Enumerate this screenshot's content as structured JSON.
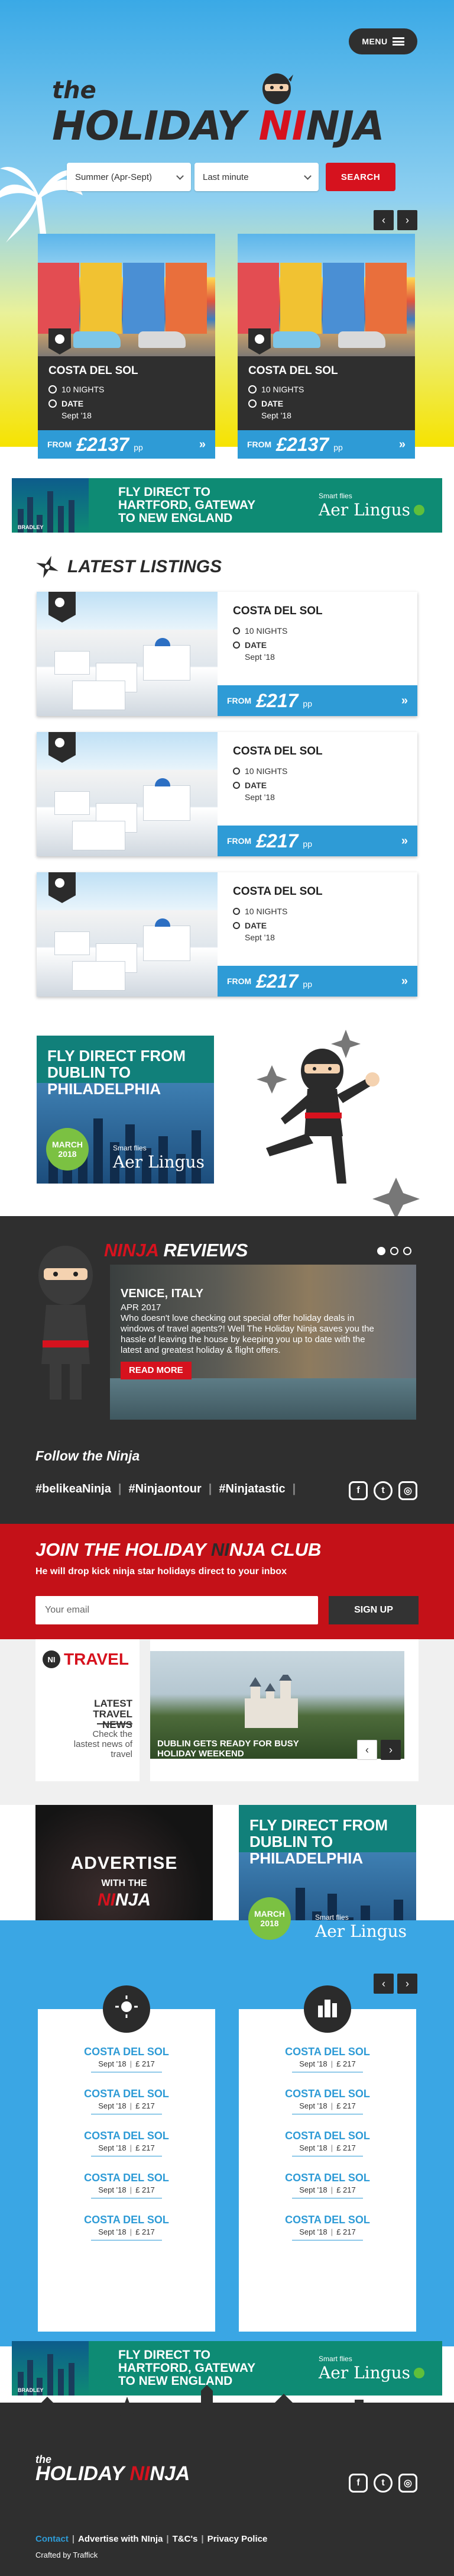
{
  "header": {
    "menu_label": "MENU",
    "logo_the": "the",
    "logo_holiday": "HOLIDAY",
    "logo_ni": "NI",
    "logo_nja": "NJA"
  },
  "search": {
    "when_value": "Summer (Apr-Sept)",
    "type_value": "Last minute",
    "button_label": "SEARCH"
  },
  "featured_deals": [
    {
      "title": "COSTA DEL SOL",
      "nights": "10 NIGHTS",
      "date_label": "DATE",
      "date": "Sept '18",
      "from": "FROM",
      "price": "£2137",
      "pp": "pp",
      "go": "»"
    },
    {
      "title": "COSTA DEL SOL",
      "nights": "10 NIGHTS",
      "date_label": "DATE",
      "date": "Sept '18",
      "from": "FROM",
      "price": "£2137",
      "pp": "pp",
      "go": "»"
    }
  ],
  "hartford_banner": {
    "headline": "FLY DIRECT TO HARTFORD, GATEWAY TO NEW ENGLAND",
    "brand_small": "Smart flies",
    "brand": "Aer Lingus",
    "badge": "BRADLEY"
  },
  "latest": {
    "title": "LATEST LISTINGS",
    "items": [
      {
        "title": "COSTA DEL SOL",
        "nights": "10 NIGHTS",
        "date_label": "DATE",
        "date": "Sept '18",
        "from": "FROM",
        "price": "£217",
        "pp": "pp",
        "go": "»"
      },
      {
        "title": "COSTA DEL SOL",
        "nights": "10 NIGHTS",
        "date_label": "DATE",
        "date": "Sept '18",
        "from": "FROM",
        "price": "£217",
        "pp": "pp",
        "go": "»"
      },
      {
        "title": "COSTA DEL SOL",
        "nights": "10 NIGHTS",
        "date_label": "DATE",
        "date": "Sept '18",
        "from": "FROM",
        "price": "£217",
        "pp": "pp",
        "go": "»"
      }
    ]
  },
  "dublin_ad": {
    "headline": "FLY DIRECT FROM DUBLIN TO PHILADELPHIA",
    "march": "MARCH 2018",
    "brand_small": "Smart flies",
    "brand": "Aer Lingus"
  },
  "reviews": {
    "title_ninja": "NINJA",
    "title_rest": "REVIEWS",
    "place": "VENICE, ITALY",
    "date": "APR 2017",
    "text": "Who doesn't love checking out special offer holiday deals in windows of travel agents?! Well The Holiday Ninja saves you the hassle of leaving the house by keeping you up to date with the latest and greatest holiday & flight offers.",
    "button": "READ MORE",
    "follow": "Follow the Ninja",
    "tags": [
      "#belikeaNinja",
      "#Ninjaontour",
      "#Ninjatastic"
    ]
  },
  "club": {
    "title_a": "JOIN THE HOLIDAY ",
    "title_ni": "NI",
    "title_b": "NJA CLUB",
    "subtitle": "He will drop kick ninja star holidays direct to your inbox",
    "email_placeholder": "Your email",
    "signup": "SIGN UP"
  },
  "news": {
    "logo_ni": "NI",
    "logo_word": "TRAVEL",
    "latest": "LATEST TRAVEL NEWS",
    "check": "Check the lastest news of travel",
    "caption": "DUBLIN GETS READY FOR BUSY HOLIDAY WEEKEND"
  },
  "advertise": {
    "line1": "ADVERTISE",
    "line2": "WITH THE",
    "ninja_a": "NI",
    "ninja_b": "NJA"
  },
  "columns": [
    [
      {
        "name": "COSTA DEL SOL",
        "date": "Sept '18",
        "price": "£ 217"
      },
      {
        "name": "COSTA DEL SOL",
        "date": "Sept '18",
        "price": "£ 217"
      },
      {
        "name": "COSTA DEL SOL",
        "date": "Sept '18",
        "price": "£ 217"
      },
      {
        "name": "COSTA DEL SOL",
        "date": "Sept '18",
        "price": "£ 217"
      },
      {
        "name": "COSTA DEL SOL",
        "date": "Sept '18",
        "price": "£ 217"
      }
    ],
    [
      {
        "name": "COSTA DEL SOL",
        "date": "Sept '18",
        "price": "£ 217"
      },
      {
        "name": "COSTA DEL SOL",
        "date": "Sept '18",
        "price": "£ 217"
      },
      {
        "name": "COSTA DEL SOL",
        "date": "Sept '18",
        "price": "£ 217"
      },
      {
        "name": "COSTA DEL SOL",
        "date": "Sept '18",
        "price": "£ 217"
      },
      {
        "name": "COSTA DEL SOL",
        "date": "Sept '18",
        "price": "£ 217"
      }
    ]
  ],
  "footer": {
    "logo_the": "the",
    "logo_holiday": "HOLIDAY ",
    "logo_ni": "NI",
    "logo_nja": "NJA",
    "links": [
      "Contact",
      "Advertise with NInja",
      "T&C's",
      "Privacy Police"
    ],
    "crafted": "Crafted by Traffick"
  },
  "colors": {
    "accent_blue": "#2e9bd6",
    "brand_red": "#d6121e",
    "dark": "#2f2f2f"
  }
}
